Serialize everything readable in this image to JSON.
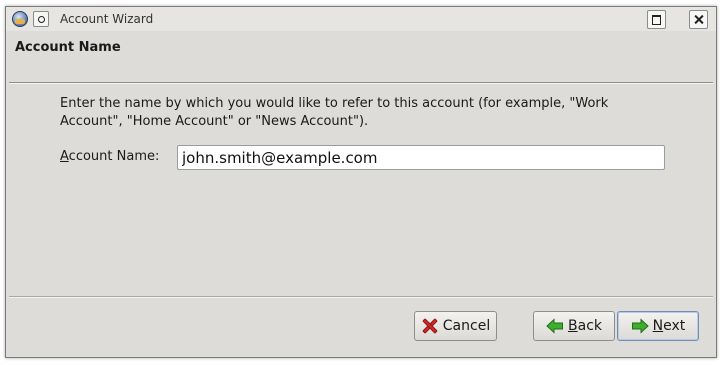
{
  "window": {
    "title": "Account Wizard"
  },
  "header": {
    "title": "Account Name"
  },
  "content": {
    "description": "Enter the name by which you would like to refer to this account (for example, \"Work Account\", \"Home Account\" or \"News Account\").",
    "account_name_label_first": "A",
    "account_name_label_rest": "ccount Name:",
    "account_name_value": "john.smith@example.com"
  },
  "footer": {
    "cancel_label": "Cancel",
    "back_label_first": "B",
    "back_label_rest": "ack",
    "next_label_first": "N",
    "next_label_rest": "ext"
  },
  "icons": {
    "app": "thunderbird-icon",
    "window_menu": "window-menu-icon",
    "maximize": "maximize-icon",
    "close": "close-icon",
    "cancel": "red-x-icon",
    "back": "green-left-arrow-icon",
    "next": "green-right-arrow-icon"
  },
  "colors": {
    "window_bg": "#dedcd9",
    "cancel_icon": "#d42a2a",
    "arrow_icon": "#3fae2e"
  }
}
